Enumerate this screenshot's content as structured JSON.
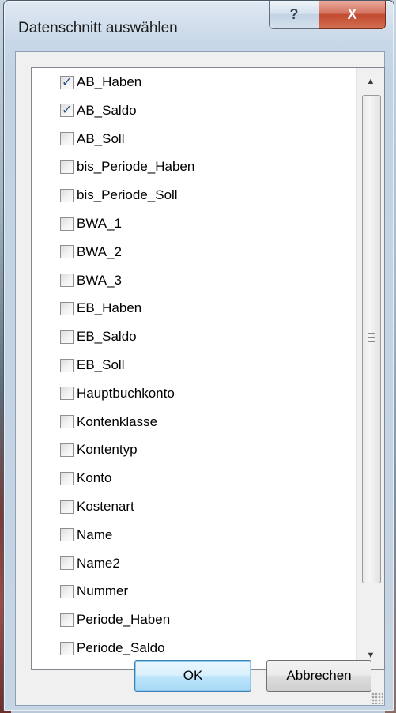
{
  "window": {
    "title": "Datenschnitt auswählen",
    "help_glyph": "?",
    "close_glyph": "X"
  },
  "list": {
    "items": [
      {
        "label": "AB_Haben",
        "checked": true
      },
      {
        "label": "AB_Saldo",
        "checked": true
      },
      {
        "label": "AB_Soll",
        "checked": false
      },
      {
        "label": "bis_Periode_Haben",
        "checked": false
      },
      {
        "label": "bis_Periode_Soll",
        "checked": false
      },
      {
        "label": "BWA_1",
        "checked": false
      },
      {
        "label": "BWA_2",
        "checked": false
      },
      {
        "label": "BWA_3",
        "checked": false
      },
      {
        "label": "EB_Haben",
        "checked": false
      },
      {
        "label": "EB_Saldo",
        "checked": false
      },
      {
        "label": "EB_Soll",
        "checked": false
      },
      {
        "label": "Hauptbuchkonto",
        "checked": false
      },
      {
        "label": "Kontenklasse",
        "checked": false
      },
      {
        "label": "Kontentyp",
        "checked": false
      },
      {
        "label": "Konto",
        "checked": false
      },
      {
        "label": "Kostenart",
        "checked": false
      },
      {
        "label": "Name",
        "checked": false
      },
      {
        "label": "Name2",
        "checked": false
      },
      {
        "label": "Nummer",
        "checked": false
      },
      {
        "label": "Periode_Haben",
        "checked": false
      },
      {
        "label": "Periode_Saldo",
        "checked": false
      }
    ]
  },
  "scrollbar": {
    "up_glyph": "▲",
    "down_glyph": "▼",
    "position_fraction": 0.0
  },
  "buttons": {
    "ok_label": "OK",
    "cancel_label": "Abbrechen"
  },
  "colors": {
    "check": "#2b4f8a",
    "close_button": "#c24a30",
    "default_button_border": "#3c7fb1"
  }
}
